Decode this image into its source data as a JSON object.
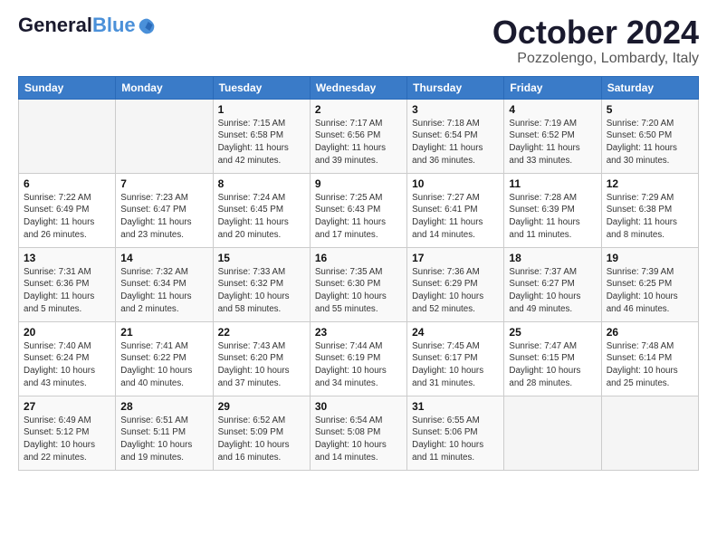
{
  "header": {
    "logo_line1": "General",
    "logo_line2": "Blue",
    "month": "October 2024",
    "location": "Pozzolengo, Lombardy, Italy"
  },
  "weekdays": [
    "Sunday",
    "Monday",
    "Tuesday",
    "Wednesday",
    "Thursday",
    "Friday",
    "Saturday"
  ],
  "weeks": [
    [
      {
        "day": "",
        "info": ""
      },
      {
        "day": "",
        "info": ""
      },
      {
        "day": "1",
        "info": "Sunrise: 7:15 AM\nSunset: 6:58 PM\nDaylight: 11 hours and 42 minutes."
      },
      {
        "day": "2",
        "info": "Sunrise: 7:17 AM\nSunset: 6:56 PM\nDaylight: 11 hours and 39 minutes."
      },
      {
        "day": "3",
        "info": "Sunrise: 7:18 AM\nSunset: 6:54 PM\nDaylight: 11 hours and 36 minutes."
      },
      {
        "day": "4",
        "info": "Sunrise: 7:19 AM\nSunset: 6:52 PM\nDaylight: 11 hours and 33 minutes."
      },
      {
        "day": "5",
        "info": "Sunrise: 7:20 AM\nSunset: 6:50 PM\nDaylight: 11 hours and 30 minutes."
      }
    ],
    [
      {
        "day": "6",
        "info": "Sunrise: 7:22 AM\nSunset: 6:49 PM\nDaylight: 11 hours and 26 minutes."
      },
      {
        "day": "7",
        "info": "Sunrise: 7:23 AM\nSunset: 6:47 PM\nDaylight: 11 hours and 23 minutes."
      },
      {
        "day": "8",
        "info": "Sunrise: 7:24 AM\nSunset: 6:45 PM\nDaylight: 11 hours and 20 minutes."
      },
      {
        "day": "9",
        "info": "Sunrise: 7:25 AM\nSunset: 6:43 PM\nDaylight: 11 hours and 17 minutes."
      },
      {
        "day": "10",
        "info": "Sunrise: 7:27 AM\nSunset: 6:41 PM\nDaylight: 11 hours and 14 minutes."
      },
      {
        "day": "11",
        "info": "Sunrise: 7:28 AM\nSunset: 6:39 PM\nDaylight: 11 hours and 11 minutes."
      },
      {
        "day": "12",
        "info": "Sunrise: 7:29 AM\nSunset: 6:38 PM\nDaylight: 11 hours and 8 minutes."
      }
    ],
    [
      {
        "day": "13",
        "info": "Sunrise: 7:31 AM\nSunset: 6:36 PM\nDaylight: 11 hours and 5 minutes."
      },
      {
        "day": "14",
        "info": "Sunrise: 7:32 AM\nSunset: 6:34 PM\nDaylight: 11 hours and 2 minutes."
      },
      {
        "day": "15",
        "info": "Sunrise: 7:33 AM\nSunset: 6:32 PM\nDaylight: 10 hours and 58 minutes."
      },
      {
        "day": "16",
        "info": "Sunrise: 7:35 AM\nSunset: 6:30 PM\nDaylight: 10 hours and 55 minutes."
      },
      {
        "day": "17",
        "info": "Sunrise: 7:36 AM\nSunset: 6:29 PM\nDaylight: 10 hours and 52 minutes."
      },
      {
        "day": "18",
        "info": "Sunrise: 7:37 AM\nSunset: 6:27 PM\nDaylight: 10 hours and 49 minutes."
      },
      {
        "day": "19",
        "info": "Sunrise: 7:39 AM\nSunset: 6:25 PM\nDaylight: 10 hours and 46 minutes."
      }
    ],
    [
      {
        "day": "20",
        "info": "Sunrise: 7:40 AM\nSunset: 6:24 PM\nDaylight: 10 hours and 43 minutes."
      },
      {
        "day": "21",
        "info": "Sunrise: 7:41 AM\nSunset: 6:22 PM\nDaylight: 10 hours and 40 minutes."
      },
      {
        "day": "22",
        "info": "Sunrise: 7:43 AM\nSunset: 6:20 PM\nDaylight: 10 hours and 37 minutes."
      },
      {
        "day": "23",
        "info": "Sunrise: 7:44 AM\nSunset: 6:19 PM\nDaylight: 10 hours and 34 minutes."
      },
      {
        "day": "24",
        "info": "Sunrise: 7:45 AM\nSunset: 6:17 PM\nDaylight: 10 hours and 31 minutes."
      },
      {
        "day": "25",
        "info": "Sunrise: 7:47 AM\nSunset: 6:15 PM\nDaylight: 10 hours and 28 minutes."
      },
      {
        "day": "26",
        "info": "Sunrise: 7:48 AM\nSunset: 6:14 PM\nDaylight: 10 hours and 25 minutes."
      }
    ],
    [
      {
        "day": "27",
        "info": "Sunrise: 6:49 AM\nSunset: 5:12 PM\nDaylight: 10 hours and 22 minutes."
      },
      {
        "day": "28",
        "info": "Sunrise: 6:51 AM\nSunset: 5:11 PM\nDaylight: 10 hours and 19 minutes."
      },
      {
        "day": "29",
        "info": "Sunrise: 6:52 AM\nSunset: 5:09 PM\nDaylight: 10 hours and 16 minutes."
      },
      {
        "day": "30",
        "info": "Sunrise: 6:54 AM\nSunset: 5:08 PM\nDaylight: 10 hours and 14 minutes."
      },
      {
        "day": "31",
        "info": "Sunrise: 6:55 AM\nSunset: 5:06 PM\nDaylight: 10 hours and 11 minutes."
      },
      {
        "day": "",
        "info": ""
      },
      {
        "day": "",
        "info": ""
      }
    ]
  ]
}
